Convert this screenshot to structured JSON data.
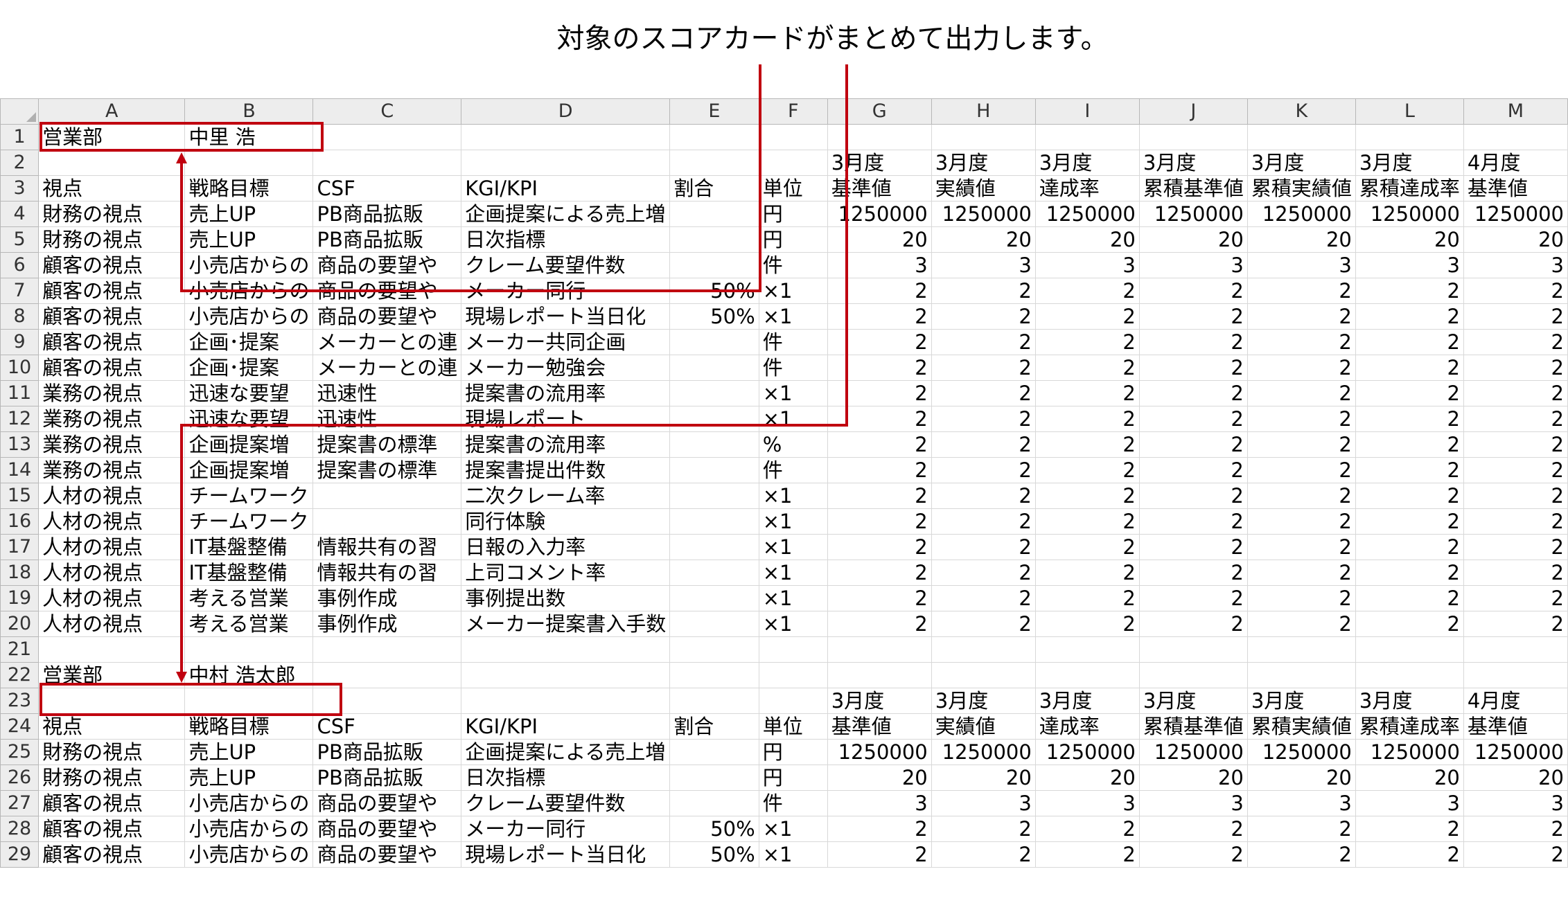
{
  "annotation": "対象のスコアカードがまとめて出力します。",
  "columns": [
    "A",
    "B",
    "C",
    "D",
    "E",
    "F",
    "G",
    "H",
    "I",
    "J",
    "K",
    "L",
    "M"
  ],
  "rows": [
    [
      "営業部",
      "中里 浩",
      "",
      "",
      "",
      "",
      "",
      "",
      "",
      "",
      "",
      "",
      ""
    ],
    [
      "",
      "",
      "",
      "",
      "",
      "",
      "3月度",
      "3月度",
      "3月度",
      "3月度",
      "3月度",
      "3月度",
      "4月度"
    ],
    [
      "視点",
      "戦略目標",
      "CSF",
      "KGI/KPI",
      "割合",
      "単位",
      "基準値",
      "実績値",
      "達成率",
      "累積基準値",
      "累積実績値",
      "累積達成率",
      "基準値"
    ],
    [
      "財務の視点",
      "売上UP",
      "PB商品拡販",
      "企画提案による売上増",
      "",
      "円",
      "1250000",
      "1250000",
      "1250000",
      "1250000",
      "1250000",
      "1250000",
      "1250000"
    ],
    [
      "財務の視点",
      "売上UP",
      "PB商品拡販",
      "日次指標",
      "",
      "円",
      "20",
      "20",
      "20",
      "20",
      "20",
      "20",
      "20"
    ],
    [
      "顧客の視点",
      "小売店からの",
      "商品の要望や",
      "クレーム要望件数",
      "",
      "件",
      "3",
      "3",
      "3",
      "3",
      "3",
      "3",
      "3"
    ],
    [
      "顧客の視点",
      "小売店からの",
      "商品の要望や",
      "メーカー同行",
      "50%",
      "×1",
      "2",
      "2",
      "2",
      "2",
      "2",
      "2",
      "2"
    ],
    [
      "顧客の視点",
      "小売店からの",
      "商品の要望や",
      "現場レポート当日化",
      "50%",
      "×1",
      "2",
      "2",
      "2",
      "2",
      "2",
      "2",
      "2"
    ],
    [
      "顧客の視点",
      "企画･提案",
      "メーカーとの連",
      "メーカー共同企画",
      "",
      "件",
      "2",
      "2",
      "2",
      "2",
      "2",
      "2",
      "2"
    ],
    [
      "顧客の視点",
      "企画･提案",
      "メーカーとの連",
      "メーカー勉強会",
      "",
      "件",
      "2",
      "2",
      "2",
      "2",
      "2",
      "2",
      "2"
    ],
    [
      "業務の視点",
      "迅速な要望",
      "迅速性",
      "提案書の流用率",
      "",
      "×1",
      "2",
      "2",
      "2",
      "2",
      "2",
      "2",
      "2"
    ],
    [
      "業務の視点",
      "迅速な要望",
      "迅速性",
      "現場レポート",
      "",
      "×1",
      "2",
      "2",
      "2",
      "2",
      "2",
      "2",
      "2"
    ],
    [
      "業務の視点",
      "企画提案増",
      "提案書の標準",
      "提案書の流用率",
      "",
      "%",
      "2",
      "2",
      "2",
      "2",
      "2",
      "2",
      "2"
    ],
    [
      "業務の視点",
      "企画提案増",
      "提案書の標準",
      "提案書提出件数",
      "",
      "件",
      "2",
      "2",
      "2",
      "2",
      "2",
      "2",
      "2"
    ],
    [
      "人材の視点",
      "チームワーク",
      "",
      "二次クレーム率",
      "",
      "×1",
      "2",
      "2",
      "2",
      "2",
      "2",
      "2",
      "2"
    ],
    [
      "人材の視点",
      "チームワーク",
      "",
      "同行体験",
      "",
      "×1",
      "2",
      "2",
      "2",
      "2",
      "2",
      "2",
      "2"
    ],
    [
      "人材の視点",
      "IT基盤整備",
      "情報共有の習",
      "日報の入力率",
      "",
      "×1",
      "2",
      "2",
      "2",
      "2",
      "2",
      "2",
      "2"
    ],
    [
      "人材の視点",
      "IT基盤整備",
      "情報共有の習",
      "上司コメント率",
      "",
      "×1",
      "2",
      "2",
      "2",
      "2",
      "2",
      "2",
      "2"
    ],
    [
      "人材の視点",
      "考える営業",
      "事例作成",
      "事例提出数",
      "",
      "×1",
      "2",
      "2",
      "2",
      "2",
      "2",
      "2",
      "2"
    ],
    [
      "人材の視点",
      "考える営業",
      "事例作成",
      "メーカー提案書入手数",
      "",
      "×1",
      "2",
      "2",
      "2",
      "2",
      "2",
      "2",
      "2"
    ],
    [
      "",
      "",
      "",
      "",
      "",
      "",
      "",
      "",
      "",
      "",
      "",
      "",
      ""
    ],
    [
      "営業部",
      "中村 浩太郎",
      "",
      "",
      "",
      "",
      "",
      "",
      "",
      "",
      "",
      "",
      ""
    ],
    [
      "",
      "",
      "",
      "",
      "",
      "",
      "3月度",
      "3月度",
      "3月度",
      "3月度",
      "3月度",
      "3月度",
      "4月度"
    ],
    [
      "視点",
      "戦略目標",
      "CSF",
      "KGI/KPI",
      "割合",
      "単位",
      "基準値",
      "実績値",
      "達成率",
      "累積基準値",
      "累積実績値",
      "累積達成率",
      "基準値"
    ],
    [
      "財務の視点",
      "売上UP",
      "PB商品拡販",
      "企画提案による売上増",
      "",
      "円",
      "1250000",
      "1250000",
      "1250000",
      "1250000",
      "1250000",
      "1250000",
      "1250000"
    ],
    [
      "財務の視点",
      "売上UP",
      "PB商品拡販",
      "日次指標",
      "",
      "円",
      "20",
      "20",
      "20",
      "20",
      "20",
      "20",
      "20"
    ],
    [
      "顧客の視点",
      "小売店からの",
      "商品の要望や",
      "クレーム要望件数",
      "",
      "件",
      "3",
      "3",
      "3",
      "3",
      "3",
      "3",
      "3"
    ],
    [
      "顧客の視点",
      "小売店からの",
      "商品の要望や",
      "メーカー同行",
      "50%",
      "×1",
      "2",
      "2",
      "2",
      "2",
      "2",
      "2",
      "2"
    ],
    [
      "顧客の視点",
      "小売店からの",
      "商品の要望や",
      "現場レポート当日化",
      "50%",
      "×1",
      "2",
      "2",
      "2",
      "2",
      "2",
      "2",
      "2"
    ]
  ],
  "colors": {
    "accent": "#c0000f",
    "header_bg": "#ededed",
    "gridline": "#d8d8d8"
  }
}
